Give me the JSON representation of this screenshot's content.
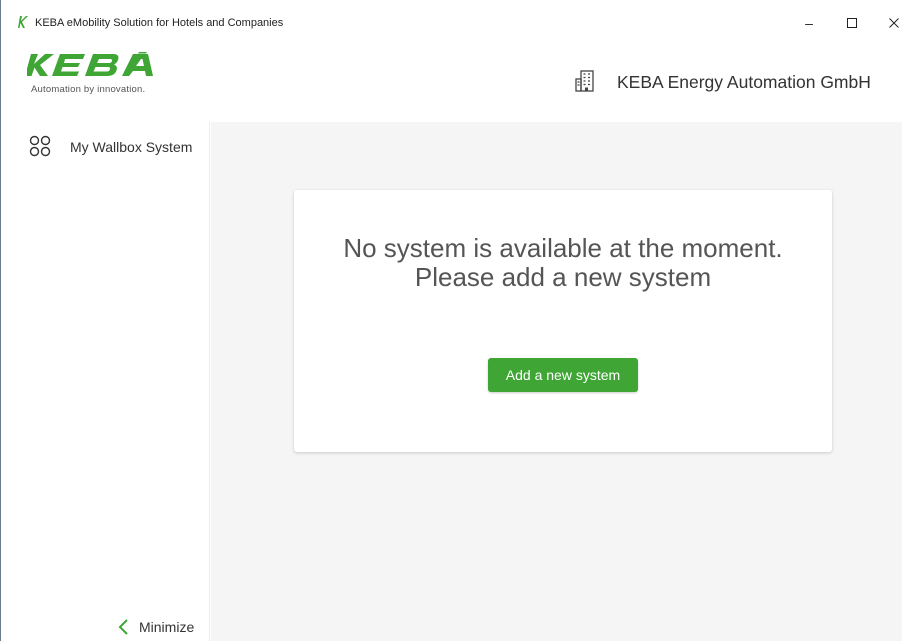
{
  "window": {
    "title": "KEBA eMobility Solution for Hotels and Companies",
    "minimize_glyph": "–",
    "maximize_glyph": "☐",
    "close_glyph": "✕"
  },
  "header": {
    "brand": "KEBA",
    "tagline": "Automation by innovation.",
    "company_name": "KEBA Energy Automation GmbH",
    "company_icon": "building-icon"
  },
  "sidebar": {
    "items": [
      {
        "label": "My Wallbox System",
        "icon": "grid-circles-icon"
      }
    ],
    "minimize_label": "Minimize",
    "minimize_icon": "chevron-left-icon"
  },
  "main": {
    "message_line1": "No system is available at the moment.",
    "message_line2": "Please add a new system",
    "add_button_label": "Add a new system"
  },
  "colors": {
    "accent": "#3fa535",
    "brand_green": "#3fa535",
    "content_bg": "#f5f5f5"
  }
}
